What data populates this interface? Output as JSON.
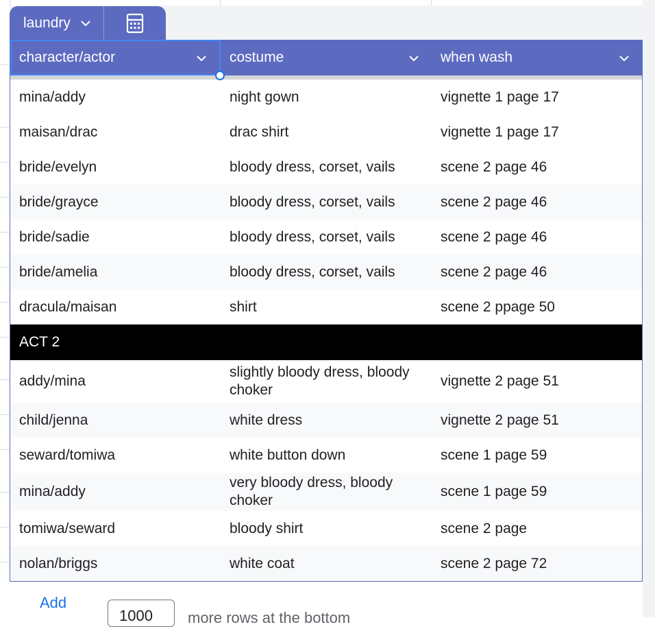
{
  "table": {
    "name": "laundry",
    "accent_color": "#5c6bc0",
    "columns": [
      "character/actor",
      "costume",
      "when wash"
    ],
    "rows": [
      {
        "character": "mina/addy",
        "costume": "night gown",
        "when": "vignette 1 page 17"
      },
      {
        "character": "maisan/drac",
        "costume": "drac shirt",
        "when": "vignette 1 page 17"
      },
      {
        "character": "bride/evelyn",
        "costume": "bloody dress, corset, vails",
        "when": "scene 2 page 46"
      },
      {
        "character": "bride/grayce",
        "costume": "bloody dress, corset, vails",
        "when": "scene 2 page 46"
      },
      {
        "character": "bride/sadie",
        "costume": "bloody dress, corset, vails",
        "when": "scene 2 page 46"
      },
      {
        "character": "bride/amelia",
        "costume": "bloody dress, corset, vails",
        "when": "scene 2 page 46"
      },
      {
        "character": "dracula/maisan",
        "costume": "shirt",
        "when": "scene 2 ppage 50"
      }
    ],
    "section": "ACT 2",
    "rows2": [
      {
        "character": "addy/mina",
        "costume": "slightly bloody dress, bloody choker",
        "when": "vignette 2 page 51"
      },
      {
        "character": "child/jenna",
        "costume": "white dress",
        "when": "vignette 2 page 51"
      },
      {
        "character": "seward/tomiwa",
        "costume": "white button down",
        "when": "scene 1 page 59"
      },
      {
        "character": "mina/addy",
        "costume": "very bloody dress, bloody choker",
        "when": "scene 1 page 59"
      },
      {
        "character": "tomiwa/seward",
        "costume": "bloody shirt",
        "when": "scene 2 page"
      },
      {
        "character": "nolan/briggs",
        "costume": "white coat",
        "when": "scene 2 page 72"
      }
    ]
  },
  "footer": {
    "add_label": "Add",
    "row_count": "1000",
    "more_text": "more rows at the bottom"
  }
}
